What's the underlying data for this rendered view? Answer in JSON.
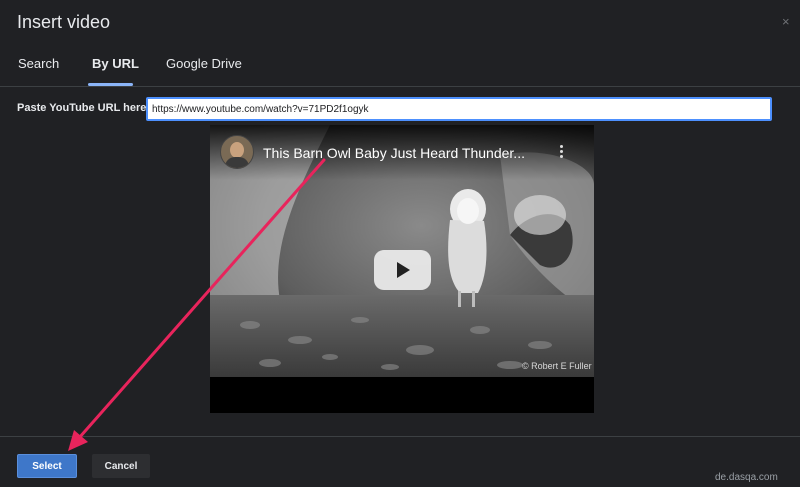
{
  "dialog": {
    "title": "Insert video",
    "close_glyph": "×"
  },
  "tabs": [
    {
      "label": "Search",
      "active": false
    },
    {
      "label": "By URL",
      "active": true
    },
    {
      "label": "Google Drive",
      "active": false
    }
  ],
  "url_field": {
    "label": "Paste YouTube URL here:",
    "value": "https://www.youtube.com/watch?v=71PD2f1ogyk"
  },
  "video": {
    "title": "This Barn Owl Baby Just Heard Thunder...",
    "watermark": "© Robert E Fuller",
    "play_icon": "play-icon"
  },
  "footer": {
    "select_label": "Select",
    "cancel_label": "Cancel"
  },
  "annotation": {
    "arrow_color": "#e8245c"
  },
  "site_watermark": "de.dasqa.com",
  "colors": {
    "background": "#202124",
    "accent": "#8ab4f8",
    "select_button": "#3e77c9"
  }
}
